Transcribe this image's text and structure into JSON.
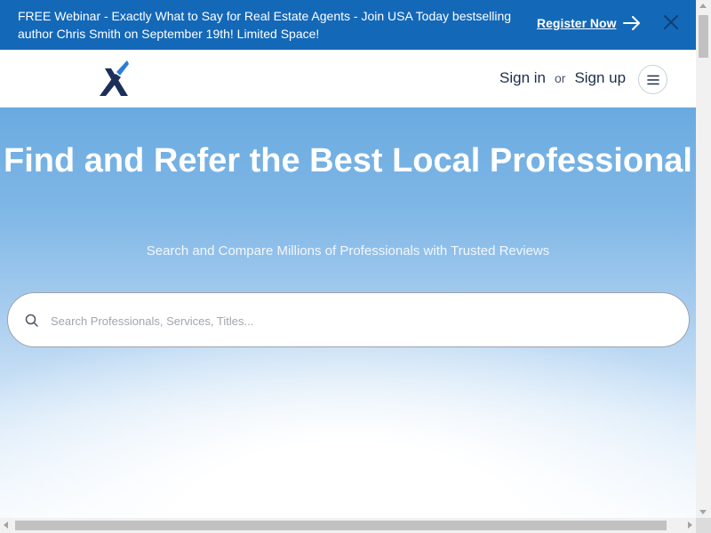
{
  "banner": {
    "text": "FREE Webinar - Exactly What to Say for Real Estate Agents - Join USA Today bestselling author Chris Smith on September 19th! Limited Space!",
    "register_label": "Register Now",
    "background": "#1468b8"
  },
  "header": {
    "logo_icon": "x-logo-icon",
    "sign_in": "Sign in",
    "or": "or",
    "sign_up": "Sign up",
    "menu_icon": "hamburger-menu-icon"
  },
  "hero": {
    "title": "Find and Refer the Best Local Professional",
    "subtitle": "Search and Compare Millions of Professionals with Trusted Reviews"
  },
  "search": {
    "placeholder": "Search Professionals, Services, Titles...",
    "value": "",
    "icon": "search-icon"
  },
  "colors": {
    "brand_dark": "#1c2e4a",
    "brand_blue": "#1468b8"
  }
}
